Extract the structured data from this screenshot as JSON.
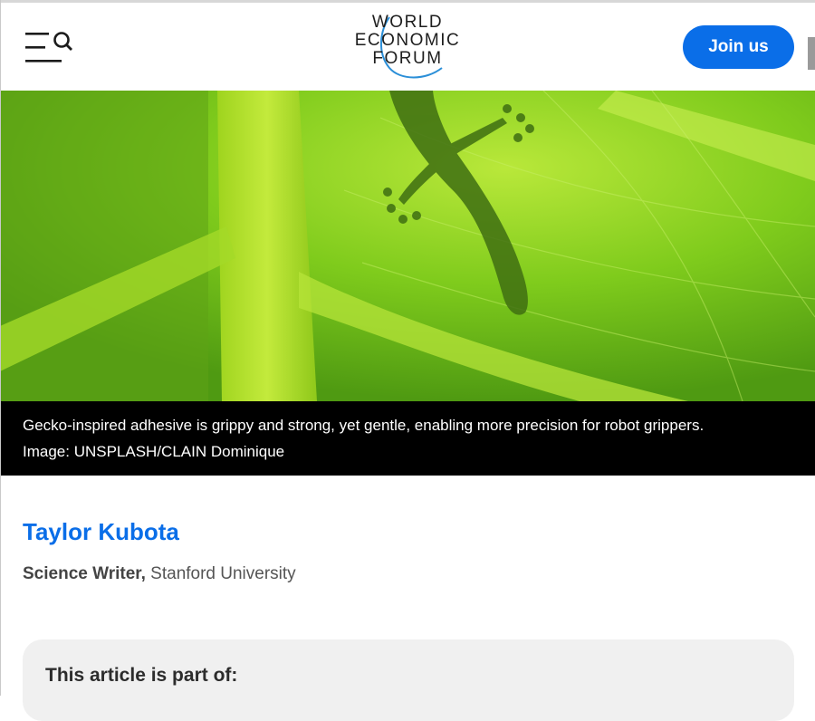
{
  "header": {
    "logo_lines": [
      "WORLD",
      "ECONOMIC",
      "FORUM"
    ],
    "join_label": "Join us",
    "menu_icon": "menu-search-icon"
  },
  "hero": {
    "alt": "Gecko silhouette on a green leaf",
    "colors": {
      "leaf": "#7cc61a",
      "vein": "#a8d81e",
      "shadow": "#3e6e12"
    }
  },
  "caption": {
    "line1": "Gecko-inspired adhesive is grippy and strong, yet gentle, enabling more precision for robot grippers.",
    "line2": "Image: UNSPLASH/CLAIN Dominique"
  },
  "author": {
    "name": "Taylor Kubota",
    "title": "Science Writer,",
    "org": " Stanford University"
  },
  "part_of": {
    "title": "This article is part of:"
  },
  "colors": {
    "accent": "#0a6ee8"
  }
}
